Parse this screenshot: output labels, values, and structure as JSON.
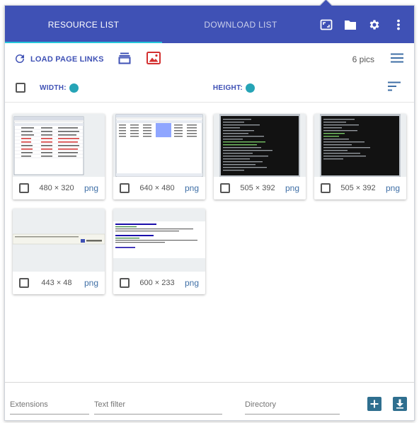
{
  "tabs": [
    {
      "label": "RESOURCE LIST",
      "active": true
    },
    {
      "label": "DOWNLOAD LIST",
      "active": false
    }
  ],
  "header_icons": [
    "fullscreen-icon",
    "folder-icon",
    "gear-icon",
    "more-vert-icon"
  ],
  "toolbar": {
    "load_label": "LOAD PAGE LINKS",
    "pics_count": "6 pics",
    "width_label": "WIDTH:",
    "height_label": "HEIGHT:"
  },
  "cards": [
    {
      "size": "480 × 320",
      "ext": "png"
    },
    {
      "size": "640 × 480",
      "ext": "png"
    },
    {
      "size": "505 × 392",
      "ext": "png"
    },
    {
      "size": "505 × 392",
      "ext": "png"
    },
    {
      "size": "443 × 48",
      "ext": "png"
    },
    {
      "size": "600 × 233",
      "ext": "png"
    }
  ],
  "footer": {
    "extensions_placeholder": "Extensions",
    "text_filter_placeholder": "Text filter",
    "directory_placeholder": "Directory"
  },
  "colors": {
    "primary": "#3f51b5",
    "accent": "#26c6da",
    "link": "#3f6fa6",
    "image_icon": "#d32f2f"
  }
}
